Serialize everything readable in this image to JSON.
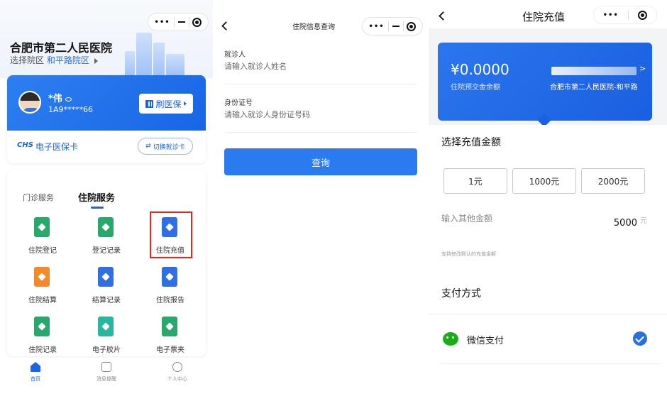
{
  "home": {
    "hospital_name": "合肥市第二人民医院",
    "campus_prefix": "选择院区",
    "campus_value": "和平路院区",
    "user_name": "*伟",
    "user_id": "1A9*****66",
    "swipe_label": "刷医保",
    "ecard_logo": "CHS",
    "ecard_label": "电子医保卡",
    "switch_label": "切换就诊卡",
    "tabs": {
      "outpatient": "门诊服务",
      "inpatient": "住院服务"
    },
    "services": [
      {
        "label": "住院登记",
        "color": "#28a86b"
      },
      {
        "label": "登记记录",
        "color": "#28a86b"
      },
      {
        "label": "住院充值",
        "color": "#2f6fe3"
      },
      {
        "label": "住院结算",
        "color": "#f28a2a"
      },
      {
        "label": "结算记录",
        "color": "#2f6fe3"
      },
      {
        "label": "住院报告",
        "color": "#2f6fe3"
      },
      {
        "label": "住院记录",
        "color": "#28a86b"
      },
      {
        "label": "电子胶片",
        "color": "#28b6a0"
      },
      {
        "label": "电子票夹",
        "color": "#28a86b"
      }
    ],
    "tabbar": [
      {
        "label": "首页",
        "icon": "home-icon"
      },
      {
        "label": "消息提醒",
        "icon": "message-icon"
      },
      {
        "label": "个人中心",
        "icon": "user-icon"
      }
    ]
  },
  "query": {
    "title": "住院信息查询",
    "patient_label": "就诊人",
    "patient_placeholder": "请输入就诊人姓名",
    "idcard_label": "身份证号",
    "idcard_placeholder": "请输入就诊人身份证号码",
    "button": "查询"
  },
  "recharge": {
    "title": "住院充值",
    "balance": "¥0.0000",
    "balance_label": "住院预交金余额",
    "hospital": "合肥市第二人民医院-和平路",
    "arrow": ">",
    "select_title": "选择充值金额",
    "amounts": [
      "1元",
      "1000元",
      "2000元"
    ],
    "other_label": "输入其他金额",
    "other_value": "5000",
    "unit": "元",
    "hint": "支持修改默认的充值金额",
    "pay_title": "支付方式",
    "pay_method": "微信支付"
  },
  "capsule": {
    "more": "•••"
  }
}
